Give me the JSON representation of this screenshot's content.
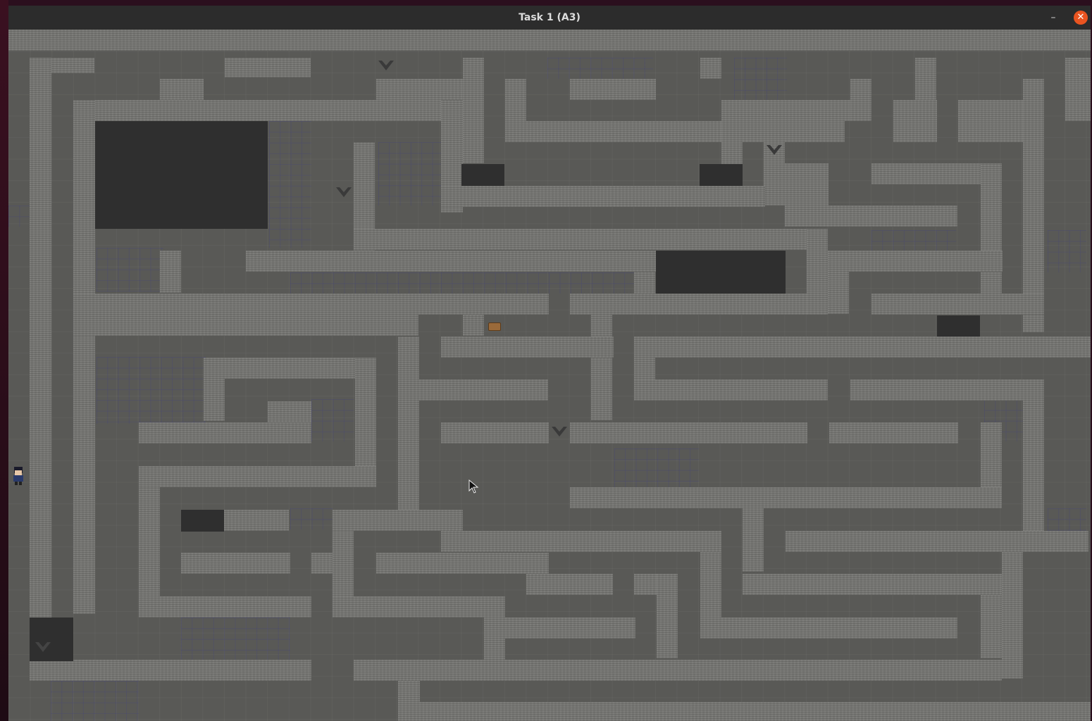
{
  "window": {
    "title": "Task 1 (A3)",
    "minimize_label": "–",
    "close_label": "✕",
    "accent_color": "#e95420"
  },
  "game": {
    "floor_color": "#595956",
    "wall_color": "#767673",
    "pit_color": "#2f2f2f",
    "sprites": {
      "player": "player-character-sprite",
      "chest": "treasure-chest-sprite",
      "trap": "spike-trap-icon"
    }
  }
}
